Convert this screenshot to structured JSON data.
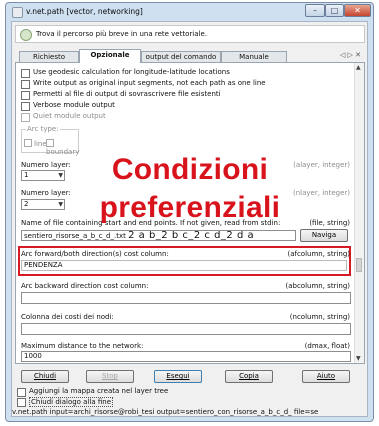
{
  "window": {
    "title": "v.net.path [vector, networking]",
    "controls": {
      "minimize": "–",
      "maximize": "□",
      "close": "✕"
    }
  },
  "description": "Trova il percorso più breve in una rete vettoriale.",
  "tabs": [
    {
      "label": "Richiesto"
    },
    {
      "label": "Opzionale"
    },
    {
      "label": "output del comando"
    },
    {
      "label": "Manuale"
    }
  ],
  "tab_nav": "◁ ▷ ✕",
  "options": {
    "geodesic": "Use geodesic calculation for longitude-latitude locations",
    "segments": "Write output as original input segments, not each path as one line",
    "overwrite": "Permetti al file di output di sovrascrivere file esistenti",
    "verbose": "Verbose module output",
    "quiet": "Quiet module output"
  },
  "arc_type": {
    "legend": "Arc type:",
    "opt_line": "line",
    "opt_boundary": "boundary"
  },
  "alayer": {
    "label": "Numero layer:",
    "hint": "(alayer, integer)",
    "value": "1"
  },
  "nlayer": {
    "label": "Numero layer:",
    "hint": "(nlayer, integer)",
    "value": "2"
  },
  "file": {
    "label": "Name of file containing start and end points. If not given, read from stdin:",
    "hint": "(file, string)",
    "value": "sentiero_risorse_a_b_c_d_.txt",
    "extra": "2 a b_2 b c_2 c d_2 d a",
    "browse": "Naviga"
  },
  "afcolumn": {
    "label": "Arc forward/both direction(s) cost column:",
    "hint": "(afcolumn, string)",
    "value": "PENDENZA"
  },
  "abcolumn": {
    "label": "Arc backward direction cost column:",
    "hint": "(abcolumn, string)",
    "value": ""
  },
  "ncolumn": {
    "label": "Colonna dei costi dei nodi:",
    "hint": "(ncolumn, string)",
    "value": ""
  },
  "dmax": {
    "label": "Maximum distance to the network:",
    "hint": "(dmax, float)",
    "value": "1000"
  },
  "annotation": {
    "line1": "Condizioni",
    "line2": "preferenziali",
    "color": "#d9131b"
  },
  "buttons": {
    "close": "Chiudi",
    "stop": "Stop",
    "run": "Esegui",
    "copy": "Copia",
    "help": "Aiuto"
  },
  "footer": {
    "add_layer": "Aggiungi la mappa creata nel layer tree",
    "close_dialog": "Chiudi dialogo alla fine",
    "command": "v.net.path input=archi_risorse@robi_tesi output=sentiero_con_risorse_a_b_c_d_ file=se"
  }
}
